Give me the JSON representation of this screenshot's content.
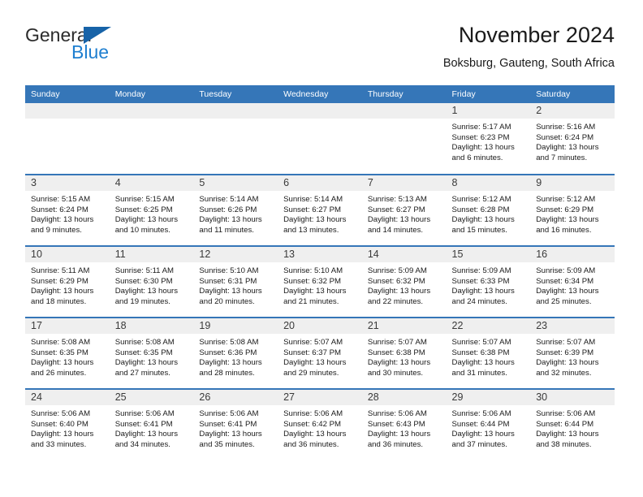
{
  "logo": {
    "word_top": "General",
    "word_bottom": "Blue",
    "triangle_icon": "triangle-flag-icon",
    "color_text": "#2b2b2b",
    "color_blue": "#1f7fd0",
    "color_triangle": "#1763a8"
  },
  "header": {
    "title": "November 2024",
    "subtitle": "Boksburg, Gauteng, South Africa"
  },
  "theme": {
    "header_blue": "#3576b8",
    "daynum_gray": "#efefef",
    "row_divider": "#3576b8"
  },
  "weekday_headers": [
    "Sunday",
    "Monday",
    "Tuesday",
    "Wednesday",
    "Thursday",
    "Friday",
    "Saturday"
  ],
  "labels": {
    "sunrise_prefix": "Sunrise:",
    "sunset_prefix": "Sunset:",
    "daylight_prefix": "Daylight:"
  },
  "weeks": [
    [
      {
        "day": "",
        "lines": []
      },
      {
        "day": "",
        "lines": []
      },
      {
        "day": "",
        "lines": []
      },
      {
        "day": "",
        "lines": []
      },
      {
        "day": "",
        "lines": []
      },
      {
        "day": "1",
        "lines": [
          "Sunrise: 5:17 AM",
          "Sunset: 6:23 PM",
          "Daylight: 13 hours and 6 minutes."
        ]
      },
      {
        "day": "2",
        "lines": [
          "Sunrise: 5:16 AM",
          "Sunset: 6:24 PM",
          "Daylight: 13 hours and 7 minutes."
        ]
      }
    ],
    [
      {
        "day": "3",
        "lines": [
          "Sunrise: 5:15 AM",
          "Sunset: 6:24 PM",
          "Daylight: 13 hours and 9 minutes."
        ]
      },
      {
        "day": "4",
        "lines": [
          "Sunrise: 5:15 AM",
          "Sunset: 6:25 PM",
          "Daylight: 13 hours and 10 minutes."
        ]
      },
      {
        "day": "5",
        "lines": [
          "Sunrise: 5:14 AM",
          "Sunset: 6:26 PM",
          "Daylight: 13 hours and 11 minutes."
        ]
      },
      {
        "day": "6",
        "lines": [
          "Sunrise: 5:14 AM",
          "Sunset: 6:27 PM",
          "Daylight: 13 hours and 13 minutes."
        ]
      },
      {
        "day": "7",
        "lines": [
          "Sunrise: 5:13 AM",
          "Sunset: 6:27 PM",
          "Daylight: 13 hours and 14 minutes."
        ]
      },
      {
        "day": "8",
        "lines": [
          "Sunrise: 5:12 AM",
          "Sunset: 6:28 PM",
          "Daylight: 13 hours and 15 minutes."
        ]
      },
      {
        "day": "9",
        "lines": [
          "Sunrise: 5:12 AM",
          "Sunset: 6:29 PM",
          "Daylight: 13 hours and 16 minutes."
        ]
      }
    ],
    [
      {
        "day": "10",
        "lines": [
          "Sunrise: 5:11 AM",
          "Sunset: 6:29 PM",
          "Daylight: 13 hours and 18 minutes."
        ]
      },
      {
        "day": "11",
        "lines": [
          "Sunrise: 5:11 AM",
          "Sunset: 6:30 PM",
          "Daylight: 13 hours and 19 minutes."
        ]
      },
      {
        "day": "12",
        "lines": [
          "Sunrise: 5:10 AM",
          "Sunset: 6:31 PM",
          "Daylight: 13 hours and 20 minutes."
        ]
      },
      {
        "day": "13",
        "lines": [
          "Sunrise: 5:10 AM",
          "Sunset: 6:32 PM",
          "Daylight: 13 hours and 21 minutes."
        ]
      },
      {
        "day": "14",
        "lines": [
          "Sunrise: 5:09 AM",
          "Sunset: 6:32 PM",
          "Daylight: 13 hours and 22 minutes."
        ]
      },
      {
        "day": "15",
        "lines": [
          "Sunrise: 5:09 AM",
          "Sunset: 6:33 PM",
          "Daylight: 13 hours and 24 minutes."
        ]
      },
      {
        "day": "16",
        "lines": [
          "Sunrise: 5:09 AM",
          "Sunset: 6:34 PM",
          "Daylight: 13 hours and 25 minutes."
        ]
      }
    ],
    [
      {
        "day": "17",
        "lines": [
          "Sunrise: 5:08 AM",
          "Sunset: 6:35 PM",
          "Daylight: 13 hours and 26 minutes."
        ]
      },
      {
        "day": "18",
        "lines": [
          "Sunrise: 5:08 AM",
          "Sunset: 6:35 PM",
          "Daylight: 13 hours and 27 minutes."
        ]
      },
      {
        "day": "19",
        "lines": [
          "Sunrise: 5:08 AM",
          "Sunset: 6:36 PM",
          "Daylight: 13 hours and 28 minutes."
        ]
      },
      {
        "day": "20",
        "lines": [
          "Sunrise: 5:07 AM",
          "Sunset: 6:37 PM",
          "Daylight: 13 hours and 29 minutes."
        ]
      },
      {
        "day": "21",
        "lines": [
          "Sunrise: 5:07 AM",
          "Sunset: 6:38 PM",
          "Daylight: 13 hours and 30 minutes."
        ]
      },
      {
        "day": "22",
        "lines": [
          "Sunrise: 5:07 AM",
          "Sunset: 6:38 PM",
          "Daylight: 13 hours and 31 minutes."
        ]
      },
      {
        "day": "23",
        "lines": [
          "Sunrise: 5:07 AM",
          "Sunset: 6:39 PM",
          "Daylight: 13 hours and 32 minutes."
        ]
      }
    ],
    [
      {
        "day": "24",
        "lines": [
          "Sunrise: 5:06 AM",
          "Sunset: 6:40 PM",
          "Daylight: 13 hours and 33 minutes."
        ]
      },
      {
        "day": "25",
        "lines": [
          "Sunrise: 5:06 AM",
          "Sunset: 6:41 PM",
          "Daylight: 13 hours and 34 minutes."
        ]
      },
      {
        "day": "26",
        "lines": [
          "Sunrise: 5:06 AM",
          "Sunset: 6:41 PM",
          "Daylight: 13 hours and 35 minutes."
        ]
      },
      {
        "day": "27",
        "lines": [
          "Sunrise: 5:06 AM",
          "Sunset: 6:42 PM",
          "Daylight: 13 hours and 36 minutes."
        ]
      },
      {
        "day": "28",
        "lines": [
          "Sunrise: 5:06 AM",
          "Sunset: 6:43 PM",
          "Daylight: 13 hours and 36 minutes."
        ]
      },
      {
        "day": "29",
        "lines": [
          "Sunrise: 5:06 AM",
          "Sunset: 6:44 PM",
          "Daylight: 13 hours and 37 minutes."
        ]
      },
      {
        "day": "30",
        "lines": [
          "Sunrise: 5:06 AM",
          "Sunset: 6:44 PM",
          "Daylight: 13 hours and 38 minutes."
        ]
      }
    ]
  ]
}
